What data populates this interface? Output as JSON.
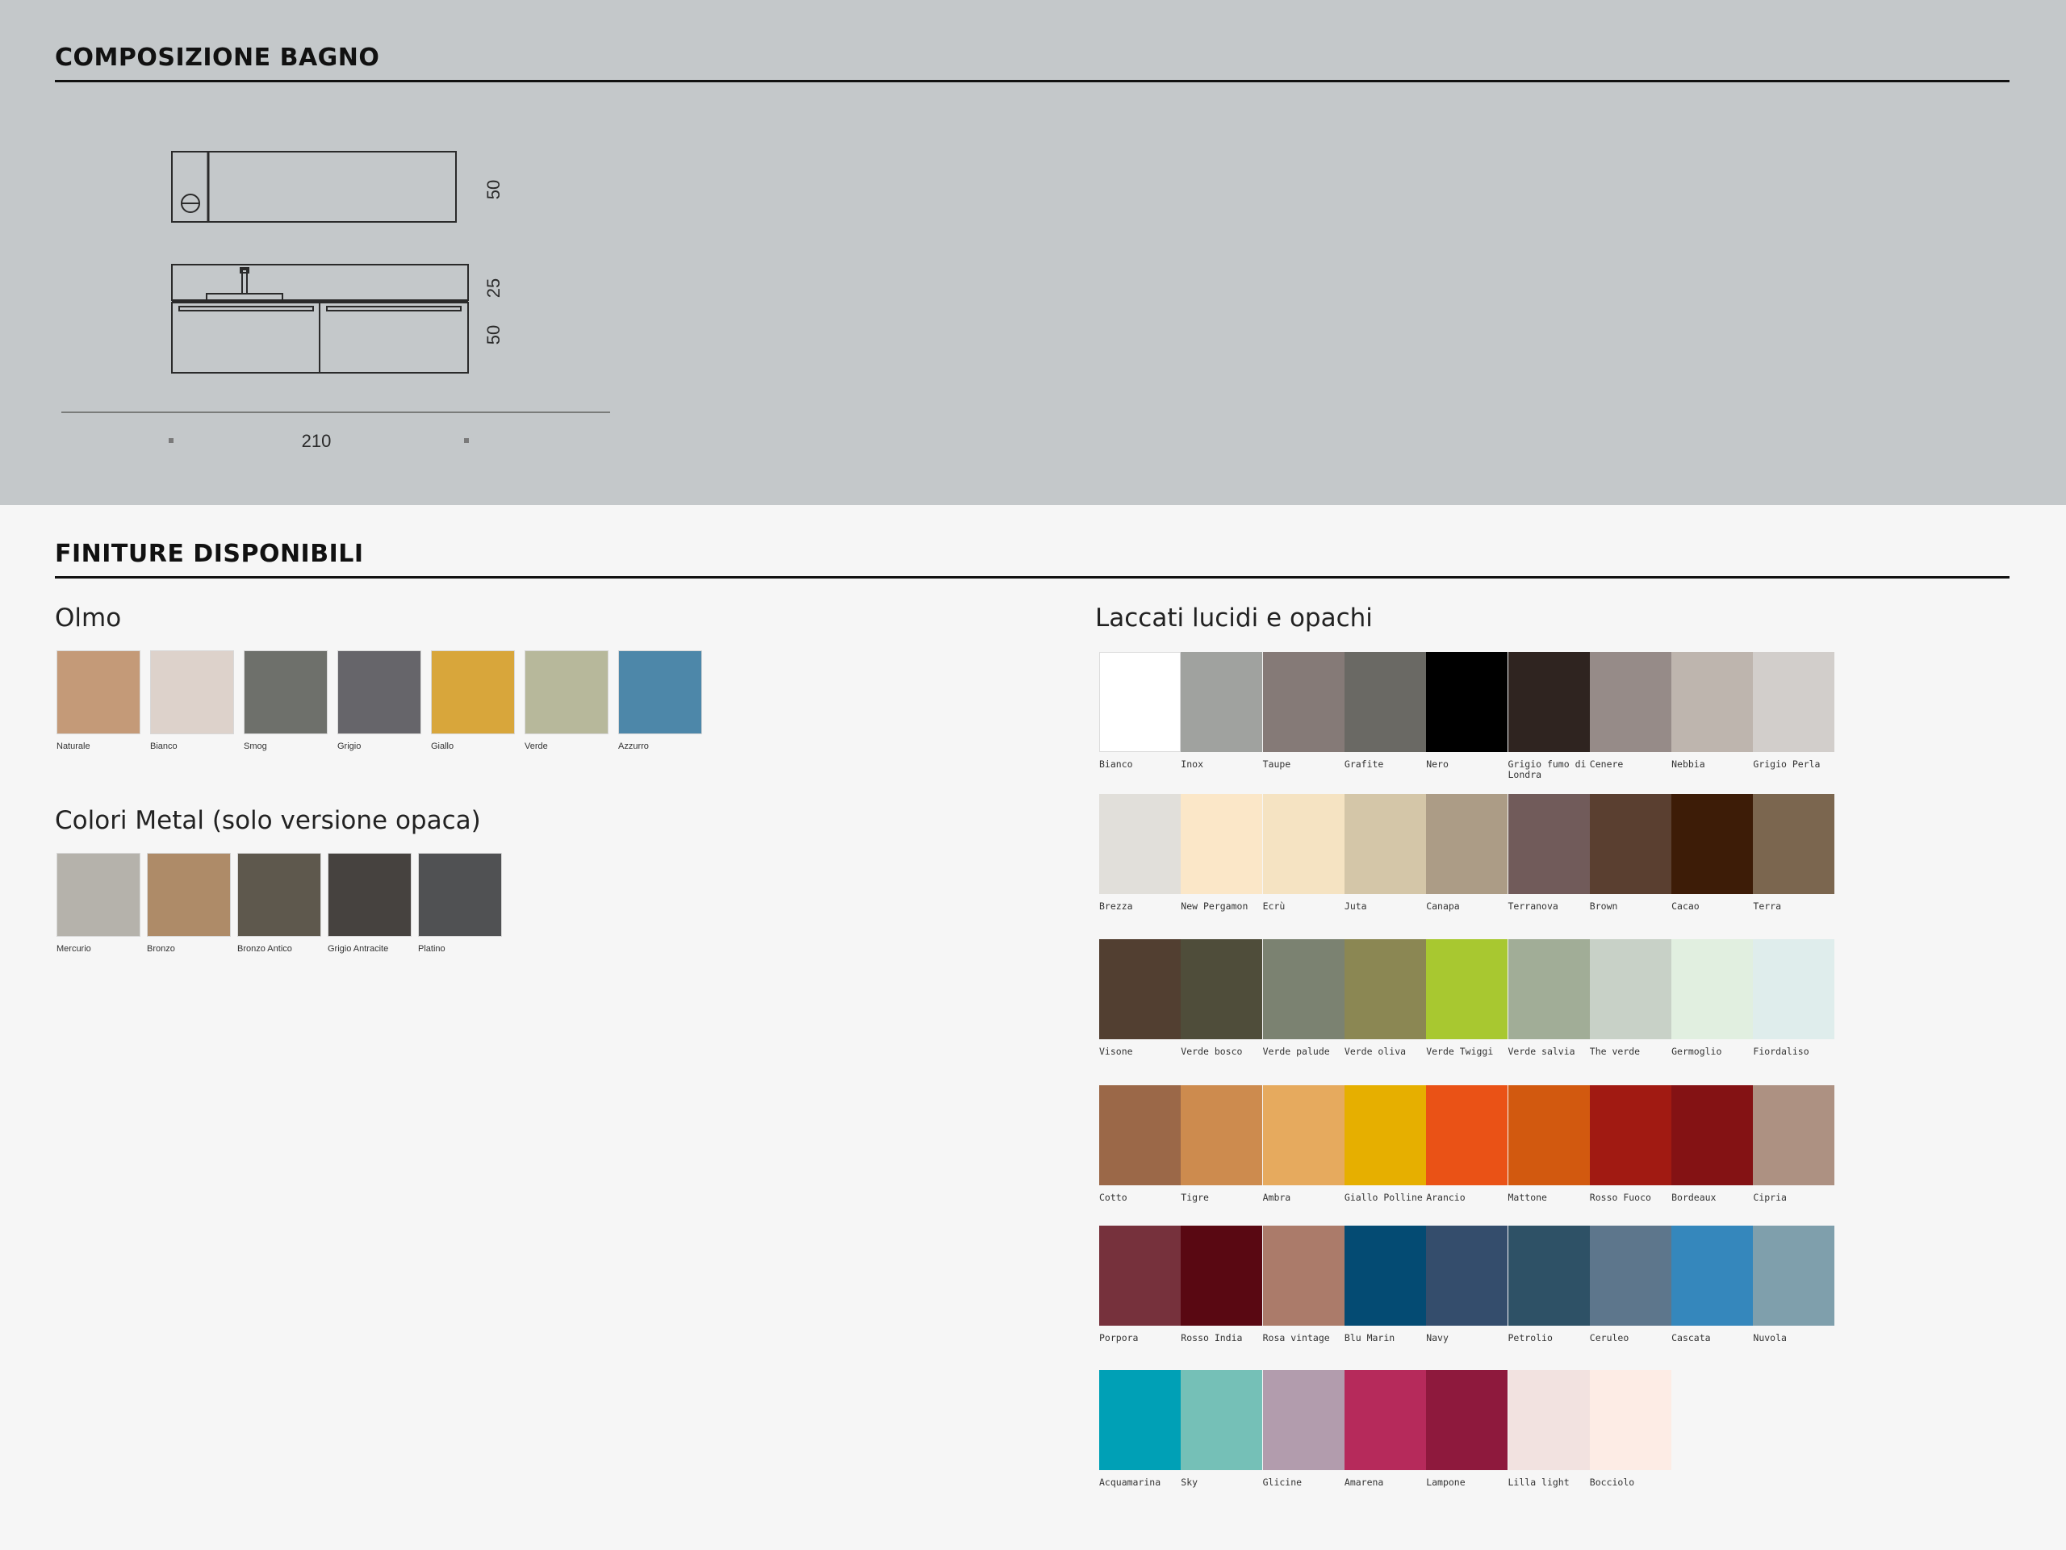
{
  "composizione": {
    "title": "COMPOSIZIONE BAGNO",
    "dimensions": {
      "top_depth": "50",
      "washbasin_height": "25",
      "cabinet_height": "50",
      "total_width": "210"
    }
  },
  "finiture": {
    "title": "FINITURE DISPONIBILI",
    "olmo": {
      "title": "Olmo",
      "items": [
        {
          "label": "Naturale",
          "color": "#c49a78"
        },
        {
          "label": "Bianco",
          "color": "#ddd2cb"
        },
        {
          "label": "Smog",
          "color": "#6e706b"
        },
        {
          "label": "Grigio",
          "color": "#66656a"
        },
        {
          "label": "Giallo",
          "color": "#d8a63b"
        },
        {
          "label": "Verde",
          "color": "#b7b89b"
        },
        {
          "label": "Azzurro",
          "color": "#4d87a9"
        }
      ]
    },
    "metal": {
      "title": "Colori Metal (solo versione opaca)",
      "items": [
        {
          "label": "Mercurio",
          "color": "#b5b2ab"
        },
        {
          "label": "Bronzo",
          "color": "#ae8b68"
        },
        {
          "label": "Bronzo Antico",
          "color": "#5e584d"
        },
        {
          "label": "Grigio Antracite",
          "color": "#46423f"
        },
        {
          "label": "Platino",
          "color": "#505153"
        }
      ]
    },
    "laccati": {
      "title": "Laccati lucidi e opachi",
      "rows": [
        [
          {
            "label": "Bianco",
            "color": "#ffffff"
          },
          {
            "label": "Inox",
            "color": "#a0a29f"
          },
          {
            "label": "Taupe",
            "color": "#857a77"
          },
          {
            "label": "Grafite",
            "color": "#6a6964"
          },
          {
            "label": "Nero",
            "color": "#000000"
          },
          {
            "label": "Grigio fumo di Londra",
            "color": "#2f2420"
          },
          {
            "label": "Cenere",
            "color": "#968b88"
          },
          {
            "label": "Nebbia",
            "color": "#beb5ae"
          },
          {
            "label": "Grigio Perla",
            "color": "#d2cecb"
          }
        ],
        [
          {
            "label": "Brezza",
            "color": "#e1dfda"
          },
          {
            "label": "New Pergamon",
            "color": "#fbe7c8"
          },
          {
            "label": "Ecrù",
            "color": "#f5e3c2"
          },
          {
            "label": "Juta",
            "color": "#d4c6a8"
          },
          {
            "label": "Canapa",
            "color": "#ac9c86"
          },
          {
            "label": "Terranova",
            "color": "#715b5a"
          },
          {
            "label": "Brown",
            "color": "#5a3f30"
          },
          {
            "label": "Cacao",
            "color": "#3d1c07"
          },
          {
            "label": "Terra",
            "color": "#7b664f"
          }
        ],
        [
          {
            "label": "Visone",
            "color": "#523f31"
          },
          {
            "label": "Verde bosco",
            "color": "#4f4d3a"
          },
          {
            "label": "Verde palude",
            "color": "#7b8271"
          },
          {
            "label": "Verde oliva",
            "color": "#8b8753"
          },
          {
            "label": "Verde Twiggi",
            "color": "#a8c830"
          },
          {
            "label": "Verde salvia",
            "color": "#a1ad97"
          },
          {
            "label": "The verde",
            "color": "#c8d1c7"
          },
          {
            "label": "Germoglio",
            "color": "#e1efe0"
          },
          {
            "label": "Fiordaliso",
            "color": "#dfedec"
          }
        ],
        [
          {
            "label": "Cotto",
            "color": "#9b6848"
          },
          {
            "label": "Tigre",
            "color": "#cd8b4e"
          },
          {
            "label": "Ambra",
            "color": "#e6aa5e"
          },
          {
            "label": "Giallo Polline",
            "color": "#e6af00"
          },
          {
            "label": "Arancio",
            "color": "#ea5216"
          },
          {
            "label": "Mattone",
            "color": "#d2590f"
          },
          {
            "label": "Rosso Fuoco",
            "color": "#a11a12"
          },
          {
            "label": "Bordeaux",
            "color": "#841214"
          },
          {
            "label": "Cipria",
            "color": "#ad9182"
          }
        ],
        [
          {
            "label": "Porpora",
            "color": "#76313c"
          },
          {
            "label": "Rosso India",
            "color": "#590812"
          },
          {
            "label": "Rosa vintage",
            "color": "#ab7b6a"
          },
          {
            "label": "Blu Marin",
            "color": "#044b73"
          },
          {
            "label": "Navy",
            "color": "#344d6c"
          },
          {
            "label": "Petrolio",
            "color": "#2e5166"
          },
          {
            "label": "Ceruleo",
            "color": "#5d768c"
          },
          {
            "label": "Cascata",
            "color": "#3587bc"
          },
          {
            "label": "Nuvola",
            "color": "#7f9fac"
          }
        ],
        [
          {
            "label": "Acquamarina",
            "color": "#00a0b6"
          },
          {
            "label": "Sky",
            "color": "#75c0b7"
          },
          {
            "label": "Glicine",
            "color": "#b29cad"
          },
          {
            "label": "Amarena",
            "color": "#b62a5b"
          },
          {
            "label": "Lampone",
            "color": "#8e193d"
          },
          {
            "label": "Lilla light",
            "color": "#f2e2e0"
          },
          {
            "label": "Bocciolo",
            "color": "#fdece5"
          }
        ]
      ]
    }
  }
}
